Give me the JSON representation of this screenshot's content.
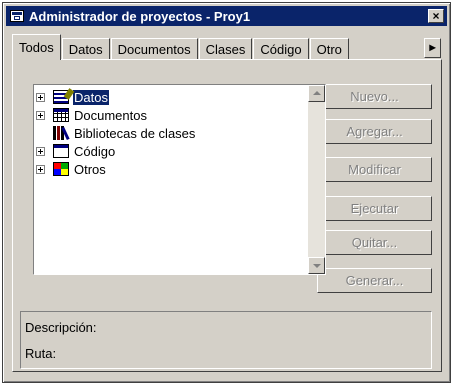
{
  "window": {
    "title": "Administrador de proyectos - Proy1",
    "close_label": "×"
  },
  "tabs": [
    "Todos",
    "Datos",
    "Documentos",
    "Clases",
    "Código",
    "Otro"
  ],
  "tab_overflow_label": "▸",
  "tree": [
    {
      "label": "Datos",
      "icon": "database-icon",
      "expandable": true,
      "selected": true
    },
    {
      "label": "Documentos",
      "icon": "documents-icon",
      "expandable": true,
      "selected": false
    },
    {
      "label": "Bibliotecas de clases",
      "icon": "class-libraries-icon",
      "expandable": false,
      "selected": false
    },
    {
      "label": "Código",
      "icon": "code-icon",
      "expandable": true,
      "selected": false
    },
    {
      "label": "Otros",
      "icon": "other-icon",
      "expandable": true,
      "selected": false
    }
  ],
  "buttons": {
    "nuevo": "Nuevo...",
    "agregar": "Agregar...",
    "modificar": "Modificar",
    "ejecutar": "Ejecutar",
    "quitar": "Quitar...",
    "generar": "Generar..."
  },
  "details": {
    "descripcion": "Descripción:",
    "ruta": "Ruta:"
  },
  "colors": {
    "titlebar": "#0a246a",
    "face": "#d4d0c8",
    "selection": "#0a246a"
  }
}
